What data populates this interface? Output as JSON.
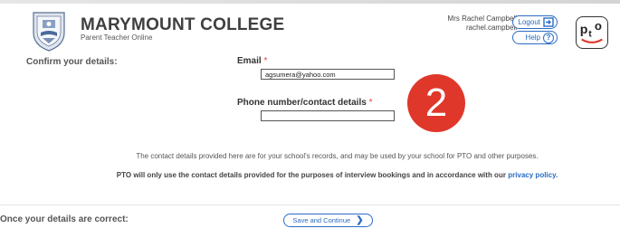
{
  "header": {
    "college_name": "MARYMOUNT COLLEGE",
    "subtitle": "Parent Teacher Online",
    "user_name": "Mrs Rachel Campbell",
    "username": "rachel.campbell",
    "logout_label": "Logout",
    "help_label": "Help",
    "logo_text": "pto"
  },
  "form": {
    "section_label": "Confirm your details:",
    "email_label": "Email",
    "email_value": "agsumera@yahoo.com",
    "phone_label": "Phone number/contact details",
    "phone_value": "",
    "required_mark": "*"
  },
  "annotation": {
    "badge_number": "2"
  },
  "notes": {
    "records_note": "The contact details provided here are for your school's records, and may be used by your school for PTO and other purposes.",
    "usage_note": "PTO will only use the contact details provided for the purposes of interview bookings and in accordance with our",
    "privacy_link": "privacy policy."
  },
  "footer": {
    "correct_label": "Once your details are correct:",
    "save_label": "Save and Continue"
  },
  "colors": {
    "accent": "#2b6cc4",
    "required": "#e0403a",
    "badge": "#e0372b"
  }
}
